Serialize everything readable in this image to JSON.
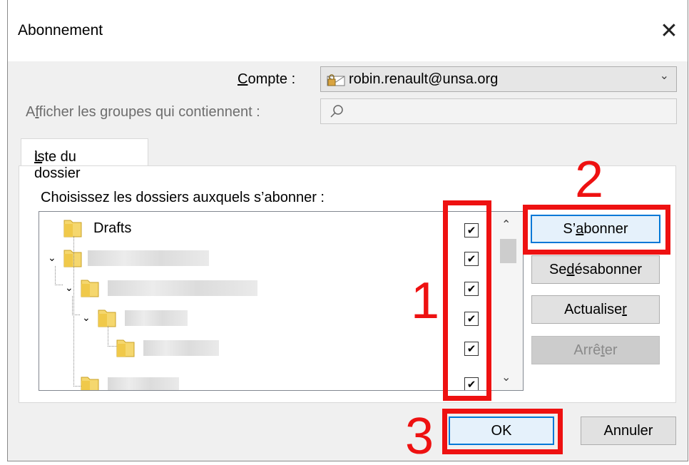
{
  "window": {
    "title": "Abonnement"
  },
  "account": {
    "label_prefix": "",
    "label_accel": "C",
    "label_rest": "ompte :",
    "value": "robin.renault@unsa.org"
  },
  "filter": {
    "label_pre": "A",
    "label_accel": "f",
    "label_rest": "ficher les groupes qui contiennent :",
    "placeholder": ""
  },
  "tab": {
    "label_accel": "L",
    "label_rest": "iste du dossier"
  },
  "folders": {
    "prompt": "Choisissez les dossiers auxquels s’abonner :",
    "first_item": "Drafts",
    "checked": [
      true,
      true,
      true,
      true,
      true,
      true
    ]
  },
  "buttons": {
    "subscribe": {
      "pre": "S’",
      "accel": "a",
      "post": "bonner"
    },
    "unsubscribe": {
      "pre": "Se ",
      "accel": "d",
      "post": "ésabonner"
    },
    "refresh": {
      "pre": "Actualise",
      "accel": "r",
      "post": ""
    },
    "stop": {
      "pre": "Arrê",
      "accel": "t",
      "post": "er"
    },
    "ok": "OK",
    "cancel": "Annuler"
  },
  "annotations": {
    "n1": "1",
    "n2": "2",
    "n3": "3",
    "color": "#ee1111"
  },
  "icons": [
    "close-icon",
    "account-icon",
    "chevron-down-icon",
    "search-icon",
    "folder-icon",
    "expand-icon",
    "chevron-up-icon"
  ]
}
